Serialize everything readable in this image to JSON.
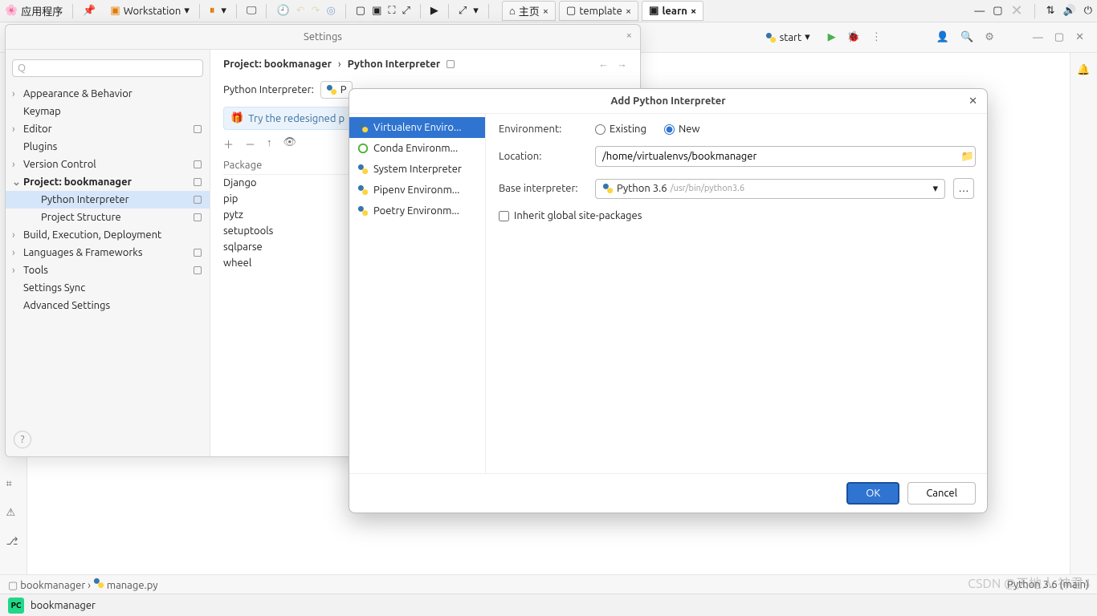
{
  "topbar": {
    "app_menu": "应用程序",
    "workstation": "Workstation",
    "tabs": [
      {
        "label": "主页"
      },
      {
        "label": "template"
      },
      {
        "label": "learn",
        "active": true
      }
    ]
  },
  "run_config": {
    "label": "start"
  },
  "settings": {
    "title": "Settings",
    "search_placeholder": "",
    "categories": [
      {
        "label": "Appearance & Behavior",
        "arrow": true
      },
      {
        "label": "Keymap"
      },
      {
        "label": "Editor",
        "arrow": true,
        "box": true
      },
      {
        "label": "Plugins"
      },
      {
        "label": "Version Control",
        "arrow": true,
        "box": true
      },
      {
        "label": "Project: bookmanager",
        "arrow": true,
        "expanded": true,
        "box": true,
        "bold": true
      },
      {
        "label": "Python Interpreter",
        "sub": true,
        "selected": true,
        "box": true
      },
      {
        "label": "Project Structure",
        "sub": true,
        "box": true
      },
      {
        "label": "Build, Execution, Deployment",
        "arrow": true
      },
      {
        "label": "Languages & Frameworks",
        "arrow": true,
        "box": true
      },
      {
        "label": "Tools",
        "arrow": true,
        "box": true
      },
      {
        "label": "Settings Sync"
      },
      {
        "label": "Advanced Settings"
      }
    ],
    "crumb_project": "Project: bookmanager",
    "crumb_page": "Python Interpreter",
    "interp_label": "Python Interpreter:",
    "interp_value": "P",
    "promo": "Try the redesigned p",
    "pkg_header": "Package",
    "packages": [
      "Django",
      "pip",
      "pytz",
      "setuptools",
      "sqlparse",
      "wheel"
    ]
  },
  "add_dialog": {
    "title": "Add Python Interpreter",
    "sources": [
      {
        "label": "Virtualenv Enviro...",
        "icon": "python",
        "selected": true
      },
      {
        "label": "Conda Environm...",
        "icon": "conda"
      },
      {
        "label": "System Interpreter",
        "icon": "python"
      },
      {
        "label": "Pipenv Environm...",
        "icon": "python"
      },
      {
        "label": "Poetry Environm...",
        "icon": "python"
      }
    ],
    "env_label": "Environment:",
    "env_existing": "Existing",
    "env_new": "New",
    "loc_label": "Location:",
    "loc_value": "/home/virtualenvs/bookmanager",
    "base_label": "Base interpreter:",
    "base_value": "Python 3.6",
    "base_hint": "/usr/bin/python3.6",
    "inherit": "Inherit global site-packages",
    "ok": "OK",
    "cancel": "Cancel"
  },
  "breadcrumbs": {
    "project": "bookmanager",
    "file": "manage.py",
    "status": "Python 3.6 (main)"
  },
  "status": {
    "project": "bookmanager"
  },
  "watermark": "CSDN @天地人·神君4"
}
